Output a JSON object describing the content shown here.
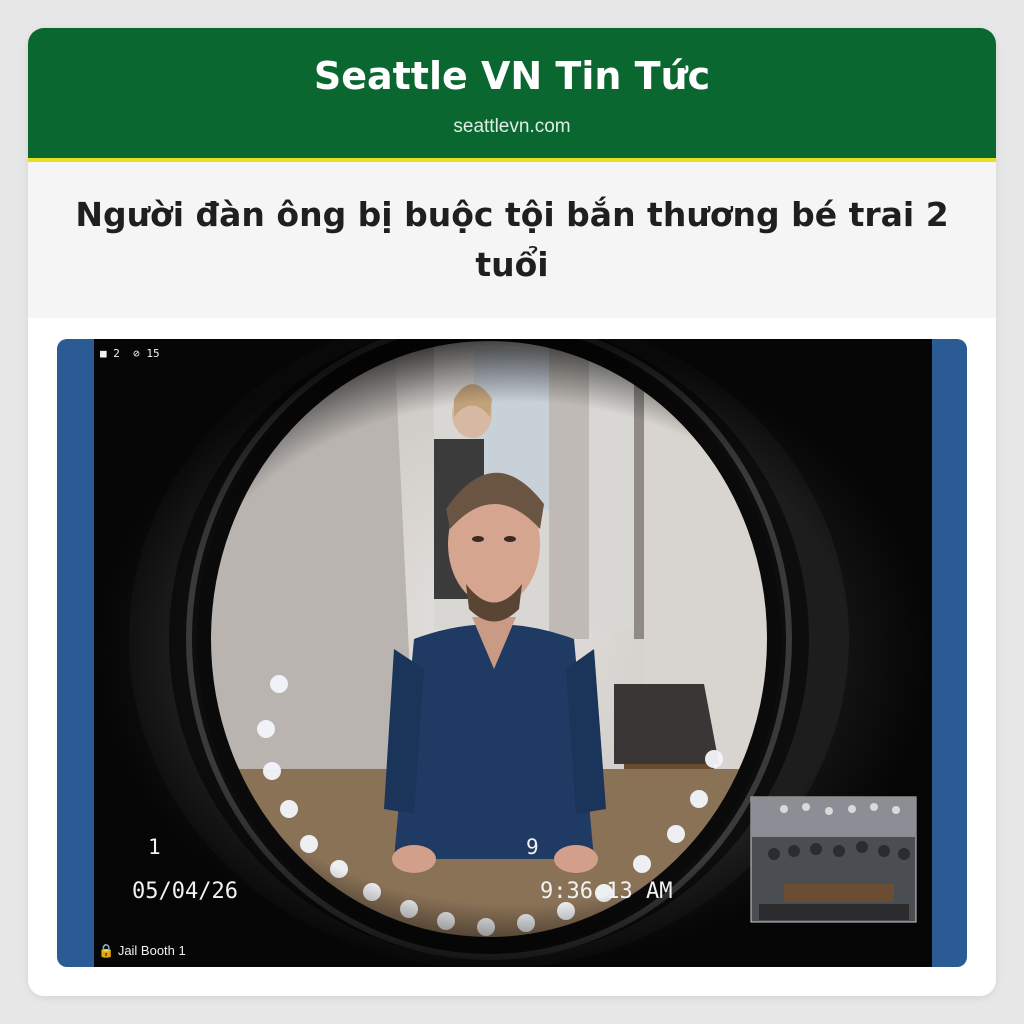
{
  "header": {
    "site_name": "Seattle VN Tin Tức",
    "site_url": "seattlevn.com"
  },
  "article": {
    "headline": "Người đàn ông bị buộc tội bắn thương bé trai 2 tuổi"
  },
  "video_overlay": {
    "camera_count": "2",
    "muted_count": "15",
    "channel_left": "1",
    "channel_right": "9",
    "date": "05/04/26",
    "time": "9:36:13 AM",
    "booth_label": "Jail Booth 1"
  },
  "colors": {
    "masthead": "#0b6730",
    "accent_rule": "#e8e01c",
    "photo_border": "#2b5b94",
    "inmate_shirt": "#1f3a63"
  }
}
